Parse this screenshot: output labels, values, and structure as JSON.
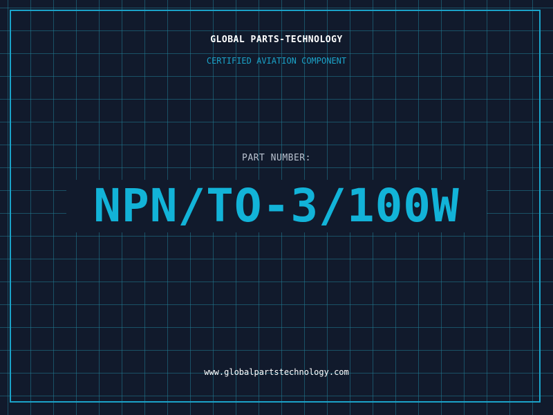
{
  "header": {
    "company": "GLOBAL PARTS-TECHNOLOGY",
    "tagline": "CERTIFIED AVIATION COMPONENT"
  },
  "main": {
    "label": "PART NUMBER:",
    "part_number": "NPN/TO-3/100W"
  },
  "footer": {
    "website": "www.globalpartstechnology.com"
  },
  "colors": {
    "background": "#111a2c",
    "grid": "#207e96",
    "accent": "#1ba3c9",
    "part_number": "#12b3d8",
    "text": "#ffffff",
    "label": "#b9c2cf"
  }
}
